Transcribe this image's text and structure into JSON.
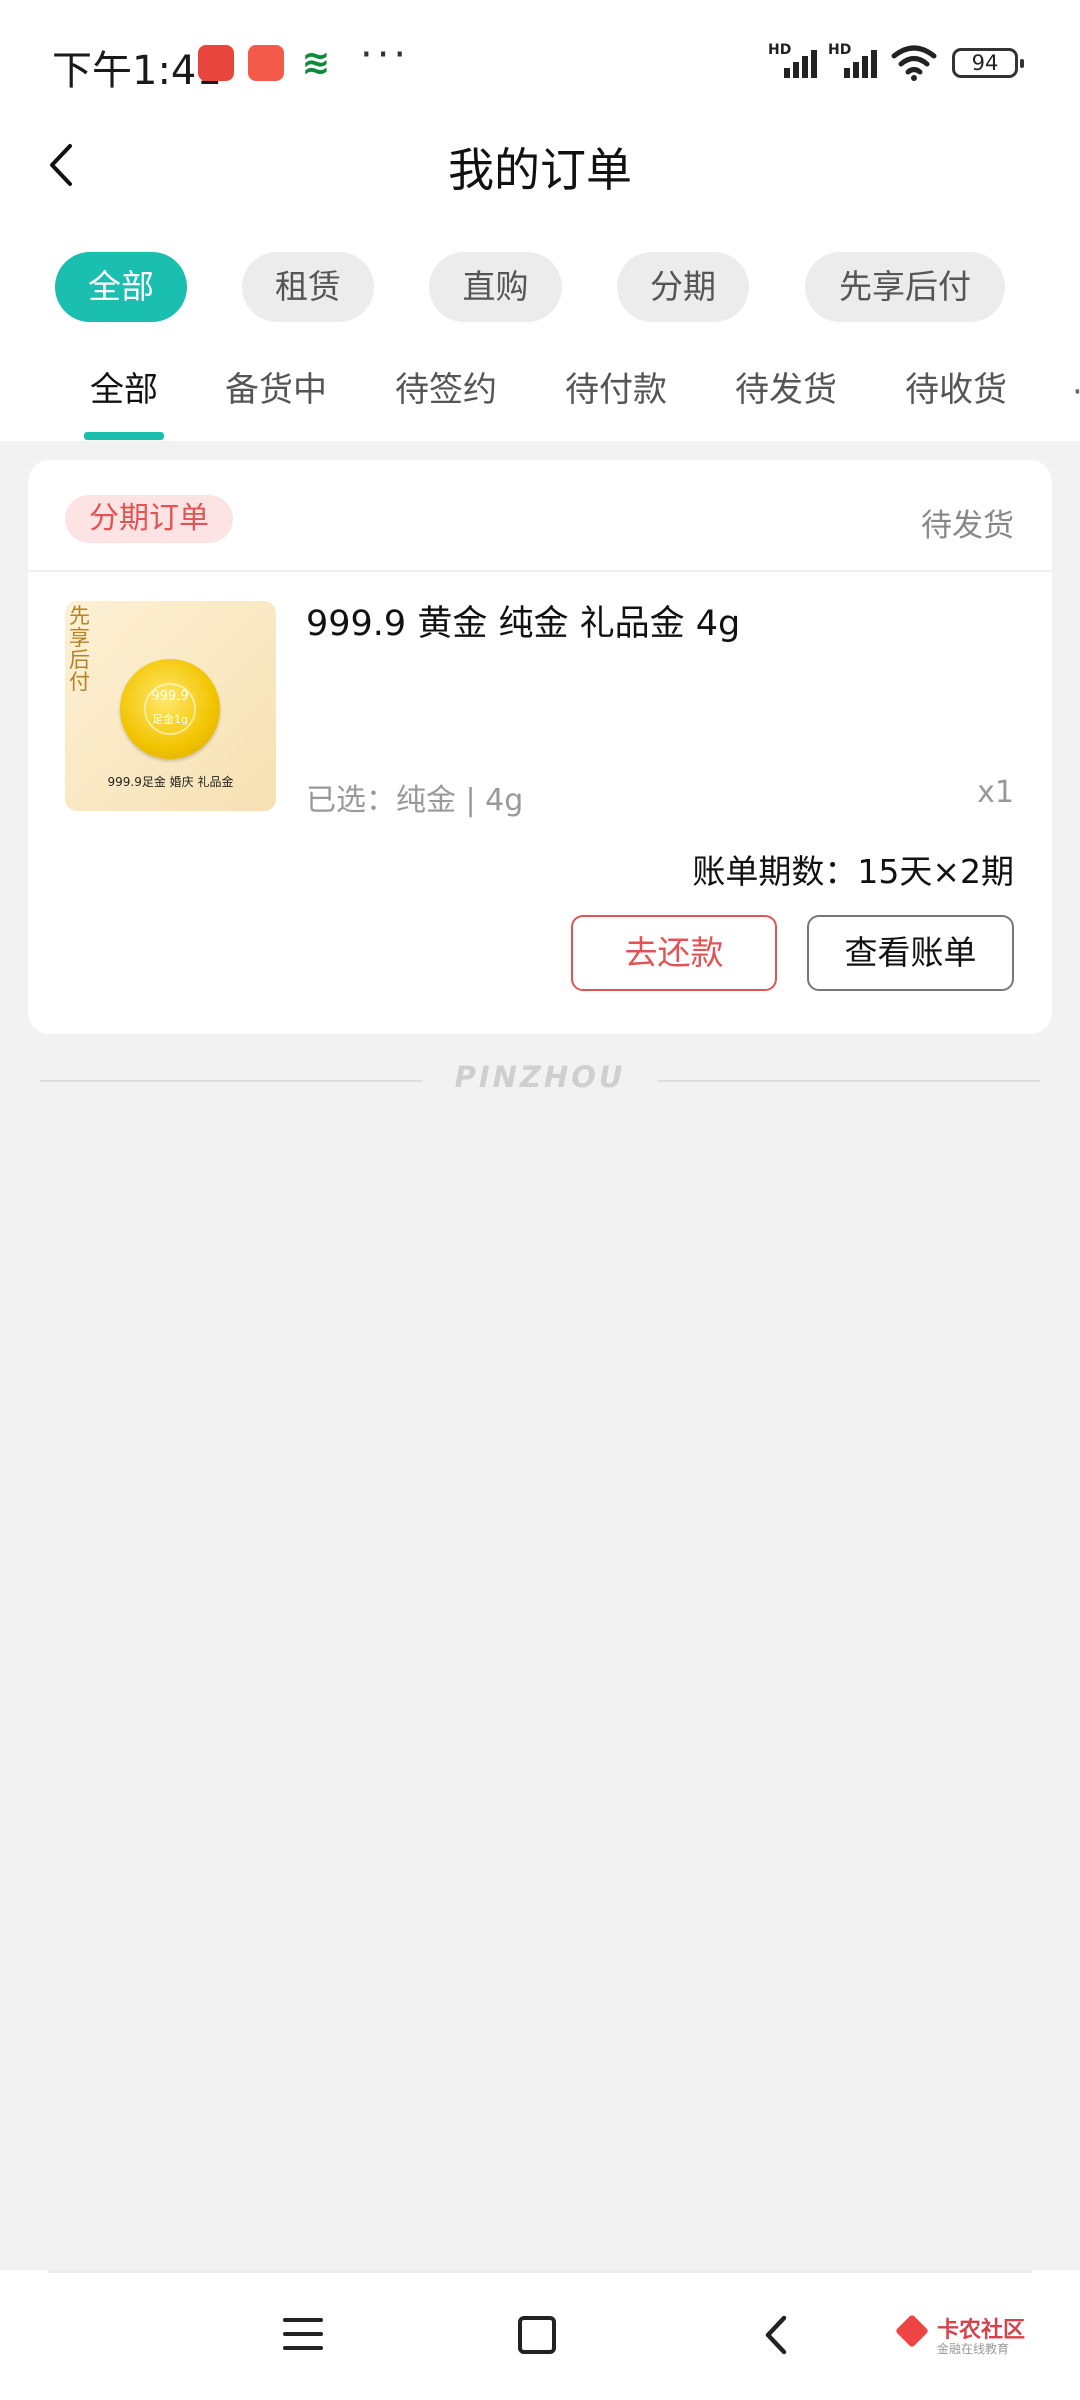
{
  "status_bar": {
    "time": "下午1:41",
    "battery": "94",
    "app_icons": [
      "search-app-icon",
      "kuaishou-icon",
      "post-office-icon"
    ],
    "more": "···",
    "signal_label_1": "HD",
    "signal_label_2": "HD"
  },
  "header": {
    "title": "我的订单"
  },
  "filter_chips": [
    {
      "label": "全部",
      "active": true
    },
    {
      "label": "租赁",
      "active": false
    },
    {
      "label": "直购",
      "active": false
    },
    {
      "label": "分期",
      "active": false
    },
    {
      "label": "先享后付",
      "active": false
    }
  ],
  "status_tabs": [
    {
      "label": "全部",
      "active": true
    },
    {
      "label": "备货中",
      "active": false
    },
    {
      "label": "待签约",
      "active": false
    },
    {
      "label": "待付款",
      "active": false
    },
    {
      "label": "待发货",
      "active": false
    },
    {
      "label": "待收货",
      "active": false
    }
  ],
  "order": {
    "type_badge": "分期订单",
    "status": "待发货",
    "product_title": "999.9 黄金 纯金 礼品金 4g",
    "spec": "已选：纯金 | 4g",
    "quantity": "x1",
    "installments": "账单期数：15天×2期",
    "repay_button": "去还款",
    "view_bill_button": "查看账单",
    "thumb": {
      "side_text": "先享后付",
      "coin_text_1": "999.9",
      "coin_text_2": "足金1g",
      "caption": "999.9足金 婚庆 礼品金"
    }
  },
  "footer_brand": "PINZHOU",
  "watermark": {
    "title": "卡农社区",
    "subtitle": "金融在线教育"
  },
  "colors": {
    "accent": "#1bbfb0",
    "danger": "#e25454",
    "badge_bg": "#fde3e3",
    "page_bg": "#f2f2f2"
  }
}
